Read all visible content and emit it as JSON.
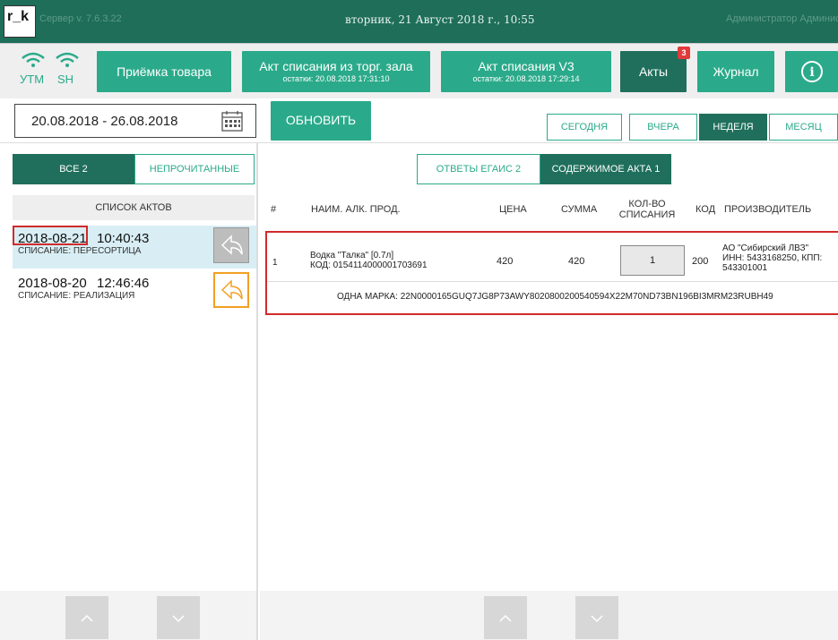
{
  "titlebar": {
    "logo": "r_k",
    "version": "Сервер v. 7.6.3.22",
    "datetime": "вторник, 21 Август 2018 г., 10:55",
    "user": "Администратор Администратор"
  },
  "toolbar": {
    "status_utm": "УТМ",
    "status_sh": "SH",
    "btn_receive": "Приёмка товара",
    "btn_writeoff_hall": "Акт списания из торг. зала",
    "btn_writeoff_hall_sub": "остатки: 20.08.2018 17:31:10",
    "btn_writeoff_v3": "Акт списания V3",
    "btn_writeoff_v3_sub": "остатки: 20.08.2018 17:29:14",
    "btn_acts": "Акты",
    "acts_badge": "3",
    "btn_journal": "Журнал",
    "btn_info": "i"
  },
  "filter": {
    "date_range": "20.08.2018 - 26.08.2018",
    "refresh": "ОБНОВИТЬ",
    "periods": [
      "СЕГОДНЯ",
      "ВЧЕРА",
      "НЕДЕЛЯ",
      "МЕСЯЦ"
    ],
    "active_period": "НЕДЕЛЯ"
  },
  "left": {
    "tab_all": "ВСЕ  2",
    "tab_unread": "НЕПРОЧИТАННЫЕ",
    "list_header": "СПИСОК АКТОВ",
    "acts": [
      {
        "date": "2018-08-21",
        "time": "10:40:43",
        "kind": "СПИСАНИЕ: ПЕРЕСОРТИЦА"
      },
      {
        "date": "2018-08-20",
        "time": "12:46:46",
        "kind": "СПИСАНИЕ: РЕАЛИЗАЦИЯ"
      }
    ]
  },
  "right": {
    "tab_answers": "ОТВЕТЫ ЕГАИС  2",
    "tab_content": "СОДЕРЖИМОЕ АКТА  1",
    "columns": {
      "num": "#",
      "name": "НАИМ. АЛК. ПРОД.",
      "price": "ЦЕНА",
      "sum": "СУММА",
      "qty": "КОЛ-ВО СПИСАНИЯ",
      "code": "КОД",
      "producer": "ПРОИЗВОДИТЕЛЬ"
    },
    "row": {
      "num": "1",
      "name": "Водка \"Талка\" [0.7л]",
      "alc_code": "КОД: 0154114000001703691",
      "price": "420",
      "sum": "420",
      "qty": "1",
      "code": "200",
      "producer_name": "АО \"Сибирский ЛВЗ\"",
      "producer_inn": "ИНН: 5433168250, КПП:",
      "producer_kpp": "543301001",
      "mark": "ОДНА МАРКА: 22N0000165GUQ7JG8P73AWY8020800200540594X22M70ND73BN196BI3MRM23RUBH49"
    }
  },
  "colors": {
    "accent": "#2aaa8a",
    "accent_dark": "#1f6f5c",
    "highlight": "#d12a2a",
    "selected_row": "#d8eef4"
  }
}
